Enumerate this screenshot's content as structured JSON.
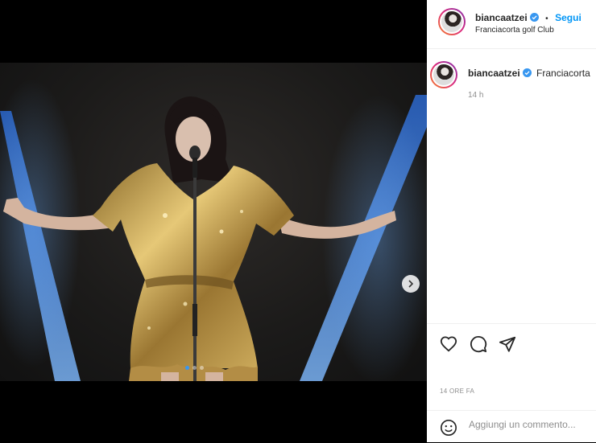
{
  "post": {
    "username": "biancaatzei",
    "separator": "•",
    "follow_label": "Segui",
    "location": "Franciacorta golf Club",
    "caption_preview": "Franciacorta",
    "caption_time": "14 h",
    "post_time": "14 ORE FA",
    "comment_placeholder": "Aggiungi un commento..."
  },
  "carousel": {
    "dot_count": 3,
    "active_index": 0
  },
  "colors": {
    "accent": "#0095f6",
    "verified": "#3897f0",
    "dress": "#c7a24a",
    "stage_light": "#3f8dff"
  },
  "icons": [
    "verified-icon",
    "chevron-right-icon",
    "heart-icon",
    "comment-icon",
    "share-icon",
    "emoji-icon"
  ]
}
